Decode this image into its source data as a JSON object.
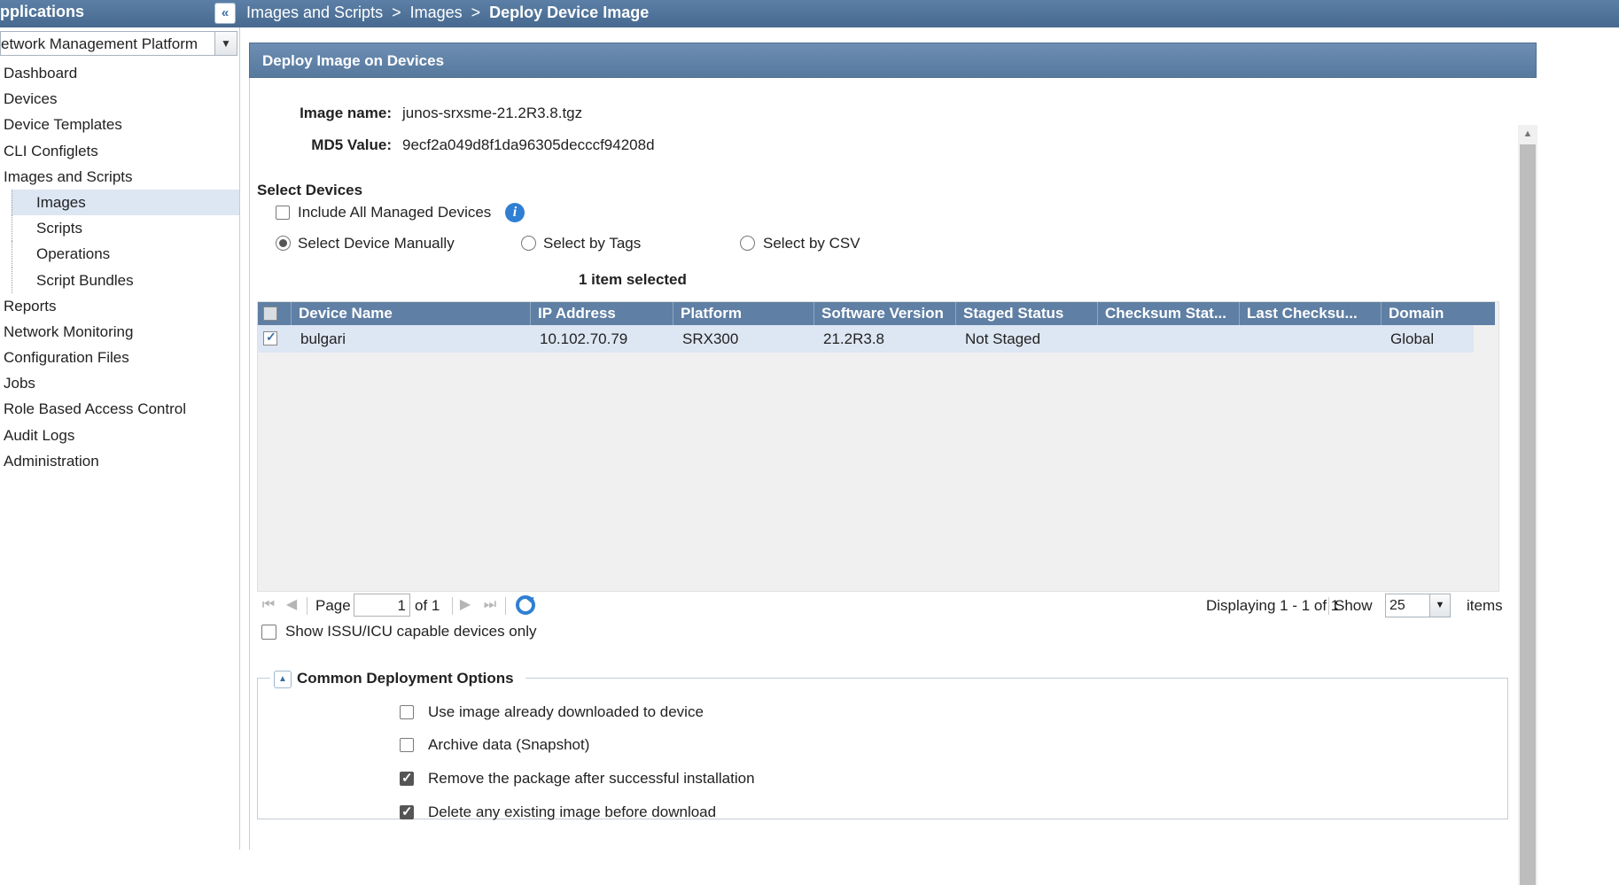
{
  "header": {
    "app_title": "pplications",
    "breadcrumb": [
      "Images and Scripts",
      "Images",
      "Deploy Device Image"
    ],
    "separator": ">"
  },
  "sidebar": {
    "platform": "etwork Management Platform",
    "items": [
      {
        "label": "Dashboard"
      },
      {
        "label": "Devices"
      },
      {
        "label": "Device Templates"
      },
      {
        "label": "CLI Configlets"
      },
      {
        "label": "Images and Scripts"
      },
      {
        "label": "Images",
        "active": true
      },
      {
        "label": "Scripts"
      },
      {
        "label": "Operations"
      },
      {
        "label": "Script Bundles"
      },
      {
        "label": "Reports"
      },
      {
        "label": "Network Monitoring"
      },
      {
        "label": "Configuration Files"
      },
      {
        "label": "Jobs"
      },
      {
        "label": "Role Based Access Control"
      },
      {
        "label": "Audit Logs"
      },
      {
        "label": "Administration"
      }
    ]
  },
  "panel": {
    "title": "Deploy Image on Devices",
    "image_name_label": "Image name:",
    "image_name": "junos-srxsme-21.2R3.8.tgz",
    "md5_label": "MD5 Value:",
    "md5": "9ecf2a049d8f1da96305decccf94208d",
    "select_devices_title": "Select Devices",
    "include_all_label": "Include All Managed Devices",
    "include_all_checked": false,
    "radio_manual": "Select Device Manually",
    "radio_tags": "Select by Tags",
    "radio_csv": "Select by CSV",
    "selected_radio": "manual",
    "selection_count": "1 item selected"
  },
  "grid": {
    "columns": [
      "Device Name",
      "IP Address",
      "Platform",
      "Software Version",
      "Staged Status",
      "Checksum Stat...",
      "Last Checksu...",
      "Domain"
    ],
    "rows": [
      {
        "checked": true,
        "device": "bulgari",
        "ip": "10.102.70.79",
        "platform": "SRX300",
        "version": "21.2R3.8",
        "staged": "Not Staged",
        "checksum": "",
        "last_checksum": "",
        "domain": "Global"
      }
    ]
  },
  "pager": {
    "page_label": "Page",
    "page_value": "1",
    "of_label": "of 1",
    "displaying": "Displaying 1 - 1 of 1",
    "show_label": "Show",
    "show_value": "25",
    "items_label": "items",
    "issu_label": "Show ISSU/ICU capable devices only"
  },
  "options": {
    "title": "Common Deployment Options",
    "items": [
      {
        "label": "Use image already downloaded to device",
        "checked": false
      },
      {
        "label": "Archive data (Snapshot)",
        "checked": false
      },
      {
        "label": "Remove the package after successful installation",
        "checked": true
      },
      {
        "label": "Delete any existing image before download",
        "checked": true
      }
    ]
  },
  "colors": {
    "header_blue": "#4a6d93",
    "selection": "#dde6f3",
    "info": "#2f7fd3"
  }
}
